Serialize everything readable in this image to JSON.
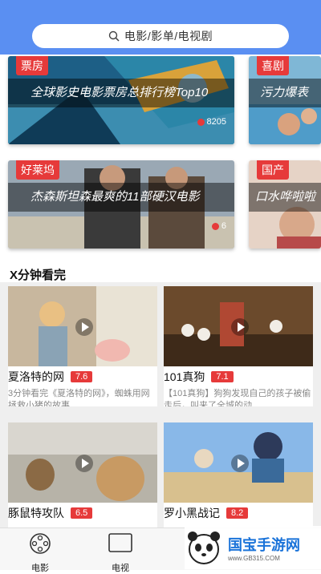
{
  "search": {
    "placeholder": "电影/影单/电视剧"
  },
  "banners_row1": [
    {
      "tag": "票房",
      "title": "全球影史电影票房总排行榜Top10",
      "views": "8205"
    },
    {
      "tag": "喜剧",
      "title": "污力爆表"
    }
  ],
  "banners_row2": [
    {
      "tag": "好莱坞",
      "title": "杰森斯坦森最爽的11部硬汉电影",
      "views": "6"
    },
    {
      "tag": "国产",
      "title": "口水哗啦啦"
    }
  ],
  "section": {
    "title": "X分钟看完"
  },
  "videos": [
    {
      "title": "夏洛特的网",
      "score": "7.6",
      "desc": "3分钟看完《夏洛特的网》，蜘蛛用网拯救小猪的故事"
    },
    {
      "title": "101真狗",
      "score": "7.1",
      "desc": "【101真狗】狗狗发现自己的孩子被偷走后，叫来了全城的动..."
    },
    {
      "title": "豚鼠特攻队",
      "score": "6.5",
      "desc": ""
    },
    {
      "title": "罗小黑战记",
      "score": "8.2",
      "desc": ""
    }
  ],
  "tabs": [
    {
      "label": "电影",
      "icon": "film-reel-icon"
    },
    {
      "label": "电视",
      "icon": "tv-icon"
    }
  ],
  "watermark": {
    "text": "国宝手游网",
    "url": "www.GB315.COM"
  },
  "colors": {
    "header": "#5a8ff2",
    "tag": "#e63a3a",
    "score": "#e63a3a"
  }
}
